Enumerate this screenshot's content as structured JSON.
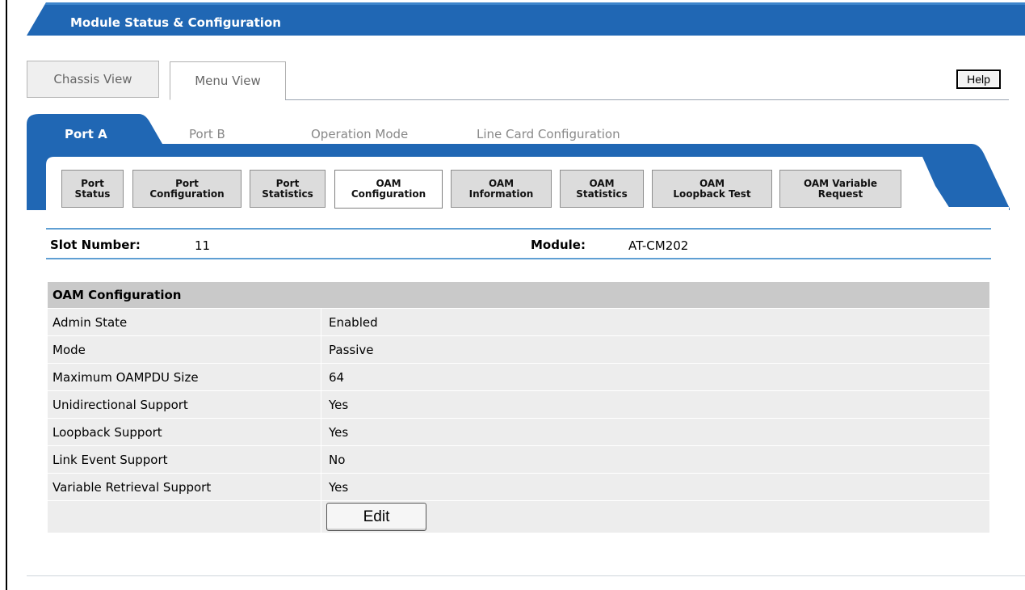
{
  "window": {
    "title": "Module Status & Configuration"
  },
  "view_tabs": [
    {
      "label": "Chassis View",
      "active": false
    },
    {
      "label": "Menu View",
      "active": true
    }
  ],
  "help_label": "Help",
  "port_tabs": [
    {
      "label": "Port A",
      "active": true
    },
    {
      "label": "Port B",
      "active": false
    },
    {
      "label": "Operation Mode",
      "active": false
    },
    {
      "label": "Line Card Configuration",
      "active": false
    }
  ],
  "sub_tabs": [
    {
      "line1": "Port",
      "line2": "Status",
      "active": false
    },
    {
      "line1": "Port",
      "line2": "Configuration",
      "active": false
    },
    {
      "line1": "Port",
      "line2": "Statistics",
      "active": false
    },
    {
      "line1": "OAM",
      "line2": "Configuration",
      "active": true
    },
    {
      "line1": "OAM",
      "line2": "Information",
      "active": false
    },
    {
      "line1": "OAM",
      "line2": "Statistics",
      "active": false
    },
    {
      "line1": "OAM",
      "line2": "Loopback Test",
      "active": false
    },
    {
      "line1": "OAM Variable",
      "line2": "Request",
      "active": false
    }
  ],
  "info": {
    "slot_label": "Slot Number:",
    "slot_value": "11",
    "module_label": "Module:",
    "module_value": "AT-CM202"
  },
  "config": {
    "heading": "OAM Configuration",
    "rows": [
      {
        "label": "Admin State",
        "value": "Enabled"
      },
      {
        "label": "Mode",
        "value": "Passive"
      },
      {
        "label": "Maximum OAMPDU Size",
        "value": "64"
      },
      {
        "label": "Unidirectional Support",
        "value": "Yes"
      },
      {
        "label": "Loopback Support",
        "value": "Yes"
      },
      {
        "label": "Link Event Support",
        "value": "No"
      },
      {
        "label": "Variable Retrieval Support",
        "value": "Yes"
      }
    ],
    "edit_label": "Edit"
  },
  "colors": {
    "brand_blue": "#2067b4",
    "header_gray": "#c9c9c9",
    "row_gray": "#ededed",
    "divider_blue": "#5f9fd3"
  }
}
